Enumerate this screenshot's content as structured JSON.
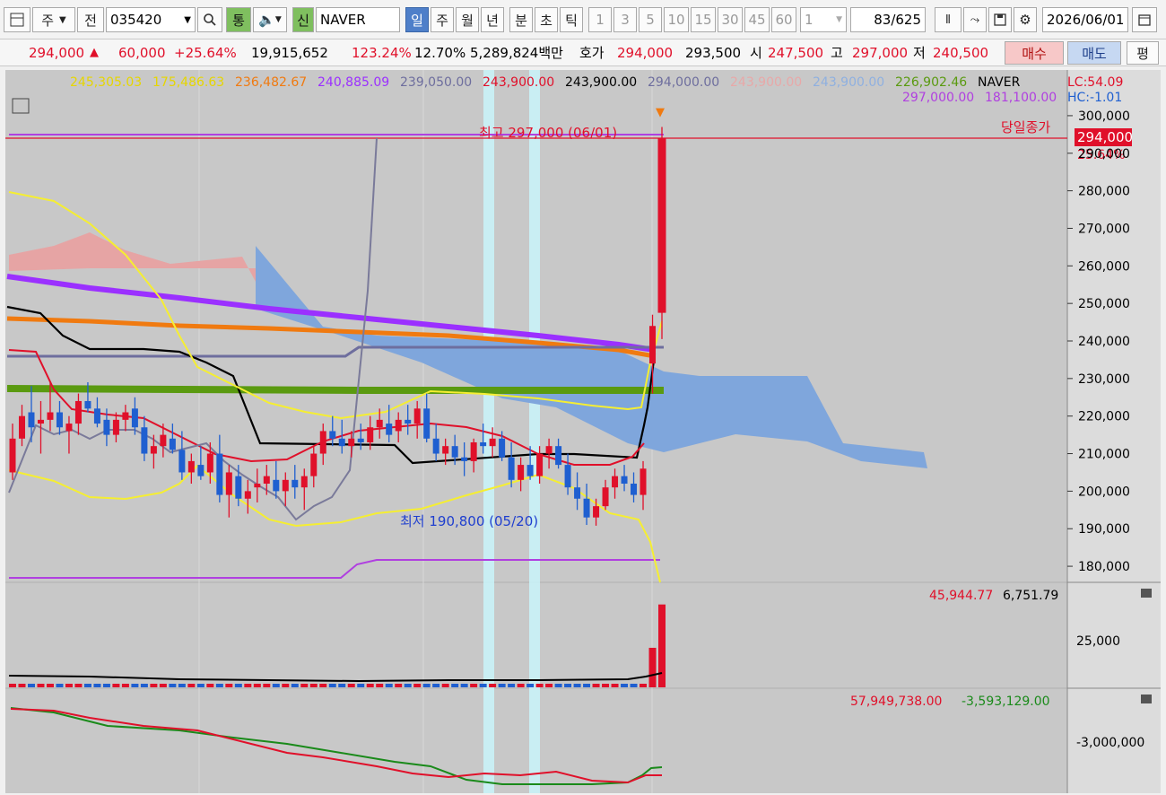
{
  "toolbar": {
    "period_type": "주",
    "prev_label": "전",
    "stock_code": "035420",
    "tong_label": "통",
    "shin_label": "신",
    "stock_name": "NAVER",
    "period_tabs": [
      "일",
      "주",
      "월",
      "년",
      "분",
      "초",
      "틱"
    ],
    "active_tab": "일",
    "interval_buttons": [
      "1",
      "3",
      "5",
      "10",
      "15",
      "30",
      "45",
      "60"
    ],
    "interval_value": "1",
    "page_count": "83",
    "page_total": "/625",
    "date": "2026/06/01"
  },
  "quote": {
    "price": "294,000",
    "change": "60,000",
    "change_pct": "+25.64%",
    "volume": "19,915,652",
    "volume_ratio": "123.24%",
    "turnover": "12.70%",
    "amount": "5,289,824백만",
    "hoga_label": "호가",
    "hoga_ask": "294,000",
    "hoga_bid": "293,500",
    "open_label": "시",
    "open": "247,500",
    "high_label": "고",
    "high": "297,000",
    "low_label": "저",
    "low": "240,500",
    "buy_label": "매수",
    "sell_label": "매도",
    "eval_label": "평"
  },
  "legend": {
    "row1": [
      {
        "text": "245,305.03",
        "color": "#e6d600"
      },
      {
        "text": "175,486.63",
        "color": "#e6d600"
      },
      {
        "text": "236,482.67",
        "color": "#f07a10"
      },
      {
        "text": "240,885.09",
        "color": "#9b30ff"
      },
      {
        "text": "239,050.00",
        "color": "#6e6e9e"
      },
      {
        "text": "243,900.00",
        "color": "#e0102a"
      },
      {
        "text": "243,900.00",
        "color": "#000000"
      },
      {
        "text": "294,000.00",
        "color": "#6e6e9e"
      },
      {
        "text": "243,900.00",
        "color": "#e8a8a8"
      },
      {
        "text": "243,900.00",
        "color": "#8fb0e0"
      },
      {
        "text": "226,902.46",
        "color": "#5a9a10"
      },
      {
        "text": "NAVER",
        "color": "#000000"
      }
    ],
    "row2": [
      {
        "text": "297,000.00",
        "color": "#b040e0"
      },
      {
        "text": "181,100.00",
        "color": "#b040e0"
      }
    ],
    "lc": "LC:54.09",
    "hc": "HC:-1.01"
  },
  "annotations": {
    "high_text": "최고 297,000 (06/01)",
    "low_text": "최저 190,800 (05/20)",
    "close_label": "당일종가",
    "price_tag": "294,000",
    "pct_tag": "25.64%"
  },
  "price_axis": {
    "ticks": [
      "300,000",
      "290,000",
      "280,000",
      "270,000",
      "260,000",
      "250,000",
      "240,000",
      "230,000",
      "220,000",
      "210,000",
      "200,000",
      "190,000",
      "180,000"
    ]
  },
  "volume_panel": {
    "legend_red": "45,944.77",
    "legend_black": "6,751.79",
    "tick": "25,000"
  },
  "obv_panel": {
    "legend_red": "57,949,738.00",
    "legend_green": "-3,593,129.00",
    "tick": "-3,000,000"
  },
  "colors": {
    "up": "#e0102a",
    "down": "#1f5fd0",
    "cloud": "#7fa6dc",
    "accent": "#4e7fc9"
  },
  "chart_data": {
    "type": "candlestick",
    "symbol": "NAVER",
    "ylim": [
      175000,
      305000
    ],
    "series": [
      {
        "name": "candles",
        "values": [
          [
            205000,
            218000,
            203000,
            214000
          ],
          [
            214000,
            223000,
            212000,
            220000
          ],
          [
            221000,
            228000,
            213000,
            217000
          ],
          [
            218000,
            224000,
            210000,
            219000
          ],
          [
            219000,
            229000,
            216000,
            221000
          ],
          [
            221000,
            224000,
            215000,
            217000
          ],
          [
            216000,
            220000,
            210000,
            218000
          ],
          [
            218000,
            226000,
            215000,
            224000
          ],
          [
            224000,
            229000,
            221000,
            222000
          ],
          [
            222000,
            225000,
            217000,
            218000
          ],
          [
            219000,
            222000,
            212000,
            215000
          ],
          [
            215000,
            221000,
            213000,
            219000
          ],
          [
            219000,
            223000,
            216000,
            221000
          ],
          [
            222000,
            225000,
            215000,
            217000
          ],
          [
            217000,
            220000,
            208000,
            210000
          ],
          [
            210000,
            215000,
            206000,
            212000
          ],
          [
            212000,
            218000,
            209000,
            215000
          ],
          [
            214000,
            218000,
            210000,
            211000
          ],
          [
            211000,
            216000,
            203000,
            205000
          ],
          [
            205000,
            210000,
            202000,
            208000
          ],
          [
            207000,
            212000,
            203000,
            204000
          ],
          [
            205000,
            213000,
            202000,
            210000
          ],
          [
            210000,
            215000,
            197000,
            199000
          ],
          [
            199000,
            207000,
            193000,
            205000
          ],
          [
            204000,
            207000,
            196000,
            198000
          ],
          [
            198000,
            203000,
            194000,
            200000
          ],
          [
            201000,
            206000,
            197000,
            202000
          ],
          [
            202000,
            207000,
            199000,
            204000
          ],
          [
            203000,
            208000,
            198000,
            200000
          ],
          [
            200000,
            205000,
            196000,
            203000
          ],
          [
            203000,
            207000,
            198000,
            201000
          ],
          [
            201000,
            206000,
            195000,
            204000
          ],
          [
            204000,
            212000,
            201000,
            210000
          ],
          [
            210000,
            218000,
            207000,
            216000
          ],
          [
            216000,
            220000,
            212000,
            214000
          ],
          [
            214000,
            219000,
            210000,
            212000
          ],
          [
            212000,
            216000,
            209000,
            214000
          ],
          [
            214000,
            218000,
            211000,
            213000
          ],
          [
            213000,
            220000,
            211000,
            217000
          ],
          [
            217000,
            222000,
            214000,
            219000
          ],
          [
            218000,
            223000,
            213000,
            215000
          ],
          [
            216000,
            221000,
            213000,
            219000
          ],
          [
            219000,
            223000,
            215000,
            218000
          ],
          [
            218000,
            224000,
            214000,
            222000
          ],
          [
            222000,
            226000,
            213000,
            214000
          ],
          [
            214000,
            218000,
            208000,
            210000
          ],
          [
            210000,
            214000,
            207000,
            212000
          ],
          [
            212000,
            215000,
            207000,
            209000
          ],
          [
            209000,
            213000,
            204000,
            208000
          ],
          [
            208000,
            214000,
            205000,
            213000
          ],
          [
            213000,
            218000,
            210000,
            212000
          ],
          [
            212000,
            217000,
            209000,
            214000
          ],
          [
            214000,
            216000,
            208000,
            209000
          ],
          [
            209000,
            213000,
            201000,
            203000
          ],
          [
            203000,
            209000,
            200000,
            207000
          ],
          [
            207000,
            212000,
            203000,
            204000
          ],
          [
            204000,
            212000,
            202000,
            210000
          ],
          [
            210000,
            214000,
            206000,
            212000
          ],
          [
            212000,
            214000,
            206000,
            207000
          ],
          [
            207000,
            210000,
            199000,
            201000
          ],
          [
            201000,
            205000,
            195000,
            198000
          ],
          [
            198000,
            202000,
            191000,
            193000
          ],
          [
            193000,
            198000,
            190800,
            196000
          ],
          [
            196000,
            203000,
            195000,
            201000
          ],
          [
            201000,
            206000,
            198000,
            204000
          ],
          [
            204000,
            207000,
            200000,
            202000
          ],
          [
            202000,
            205000,
            197000,
            199000
          ],
          [
            199000,
            208000,
            195000,
            206000
          ],
          [
            234000,
            247000,
            226000,
            244000
          ],
          [
            247500,
            297000,
            240500,
            294000
          ]
        ]
      },
      {
        "name": "volume",
        "values": [
          100,
          120,
          90,
          110,
          95,
          100,
          105,
          115,
          100,
          95,
          90,
          100,
          110,
          105,
          120,
          100,
          95,
          110,
          120,
          100,
          105,
          110,
          130,
          120,
          100,
          95,
          100,
          105,
          100,
          110,
          100,
          115,
          140,
          150,
          110,
          100,
          95,
          100,
          120,
          130,
          110,
          115,
          100,
          125,
          140,
          120,
          105,
          100,
          110,
          115,
          105,
          100,
          110,
          130,
          120,
          110,
          125,
          120,
          100,
          130,
          140,
          150,
          160,
          130,
          120,
          110,
          100,
          160,
          9500,
          19915
        ]
      }
    ]
  }
}
